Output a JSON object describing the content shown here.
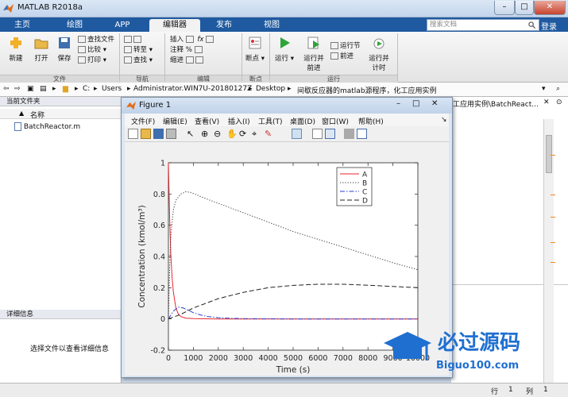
{
  "window": {
    "title": "MATLAB R2018a",
    "minimize": "–",
    "maximize": "□",
    "close": "✕"
  },
  "tabs": [
    {
      "label": "主页"
    },
    {
      "label": "绘图"
    },
    {
      "label": "APP"
    },
    {
      "label": "编辑器",
      "active": true
    },
    {
      "label": "发布"
    },
    {
      "label": "视图"
    }
  ],
  "search": {
    "placeholder": "搜索文档"
  },
  "login_label": "登录",
  "ribbon": {
    "file": {
      "group_label": "文件",
      "new": "新建",
      "open": "打开",
      "save": "保存",
      "find_files": "查找文件",
      "compare": "比较",
      "print": "打印"
    },
    "navigate": {
      "group_label": "导航",
      "goto": "转至",
      "find": "查找"
    },
    "edit": {
      "group_label": "编辑",
      "insert": "插入",
      "comment": "注释",
      "indent": "缩进"
    },
    "breakpoints": {
      "group_label": "断点",
      "breakpoints": "断点"
    },
    "run": {
      "group_label": "运行",
      "run": "运行",
      "run_advance_1": "运行并",
      "run_advance_2": "前进",
      "run_section": "运行节",
      "advance": "前进",
      "run_time_1": "运行并",
      "run_time_2": "计时"
    }
  },
  "path": {
    "drive": "C:",
    "seg1": "Users",
    "seg2": "Administrator.WIN7U-20180127Z",
    "seg3": "Desktop",
    "seg4": "间歇反应器的matlab源程序，化工应用实例",
    "behind": "工应用实例\\BatchReact..."
  },
  "current_folder": {
    "title": "当前文件夹",
    "col_name": "名称",
    "sort_arrow": "▲",
    "file": "BatchReactor.m"
  },
  "details": {
    "title": "详细信息",
    "hint": "选择文件以查看详细信息"
  },
  "status": {
    "row_label": "行",
    "row_value": "1",
    "col_label": "列",
    "col_value": "1"
  },
  "figure": {
    "title": "Figure 1",
    "menus": [
      "文件(F)",
      "编辑(E)",
      "查看(V)",
      "插入(I)",
      "工具(T)",
      "桌面(D)",
      "窗口(W)",
      "帮助(H)"
    ]
  },
  "watermark": {
    "main": "必过源码",
    "sub": "Biguo100.com"
  },
  "chart_data": {
    "type": "line",
    "xlabel": "Time (s)",
    "ylabel": "Concentration (kmol/m³)",
    "xlim": [
      0,
      10000
    ],
    "ylim": [
      -0.2,
      1.0
    ],
    "xticks": [
      0,
      1000,
      2000,
      3000,
      4000,
      5000,
      6000,
      7000,
      8000,
      9000,
      10000
    ],
    "yticks": [
      -0.2,
      0,
      0.2,
      0.4,
      0.6,
      0.8,
      1
    ],
    "grid": false,
    "legend_position": "top-right",
    "series": [
      {
        "name": "A",
        "color": "#e8262e",
        "style": "solid",
        "x": [
          0,
          50,
          100,
          150,
          200,
          300,
          400,
          500,
          700,
          1000,
          1500,
          2000,
          3000,
          5000,
          7000,
          10000
        ],
        "y": [
          1.0,
          0.64,
          0.4,
          0.26,
          0.17,
          0.07,
          0.03,
          0.015,
          0.005,
          0.002,
          0.001,
          0,
          0,
          0,
          0,
          0
        ]
      },
      {
        "name": "B",
        "color": "#333333",
        "style": "dotted",
        "x": [
          0,
          50,
          100,
          200,
          300,
          500,
          700,
          900,
          1200,
          1500,
          2000,
          3000,
          4000,
          5000,
          6000,
          7000,
          8000,
          9000,
          10000
        ],
        "y": [
          0,
          0.34,
          0.54,
          0.7,
          0.76,
          0.8,
          0.815,
          0.81,
          0.79,
          0.77,
          0.74,
          0.68,
          0.62,
          0.56,
          0.51,
          0.46,
          0.41,
          0.36,
          0.315
        ]
      },
      {
        "name": "C",
        "color": "#2a3fd0",
        "style": "dashdot",
        "x": [
          0,
          200,
          400,
          600,
          800,
          1000,
          1300,
          1600,
          2000,
          2500,
          3000,
          4000,
          5000,
          7000,
          10000
        ],
        "y": [
          0,
          0.05,
          0.075,
          0.07,
          0.055,
          0.04,
          0.025,
          0.015,
          0.008,
          0.004,
          0.002,
          0.001,
          0,
          0,
          0
        ]
      },
      {
        "name": "D",
        "color": "#222222",
        "style": "dashed",
        "x": [
          0,
          500,
          1000,
          1500,
          2000,
          3000,
          4000,
          5000,
          6000,
          7000,
          8000,
          9000,
          10000
        ],
        "y": [
          0,
          0.03,
          0.07,
          0.1,
          0.13,
          0.17,
          0.2,
          0.215,
          0.222,
          0.222,
          0.216,
          0.208,
          0.2
        ]
      }
    ]
  }
}
